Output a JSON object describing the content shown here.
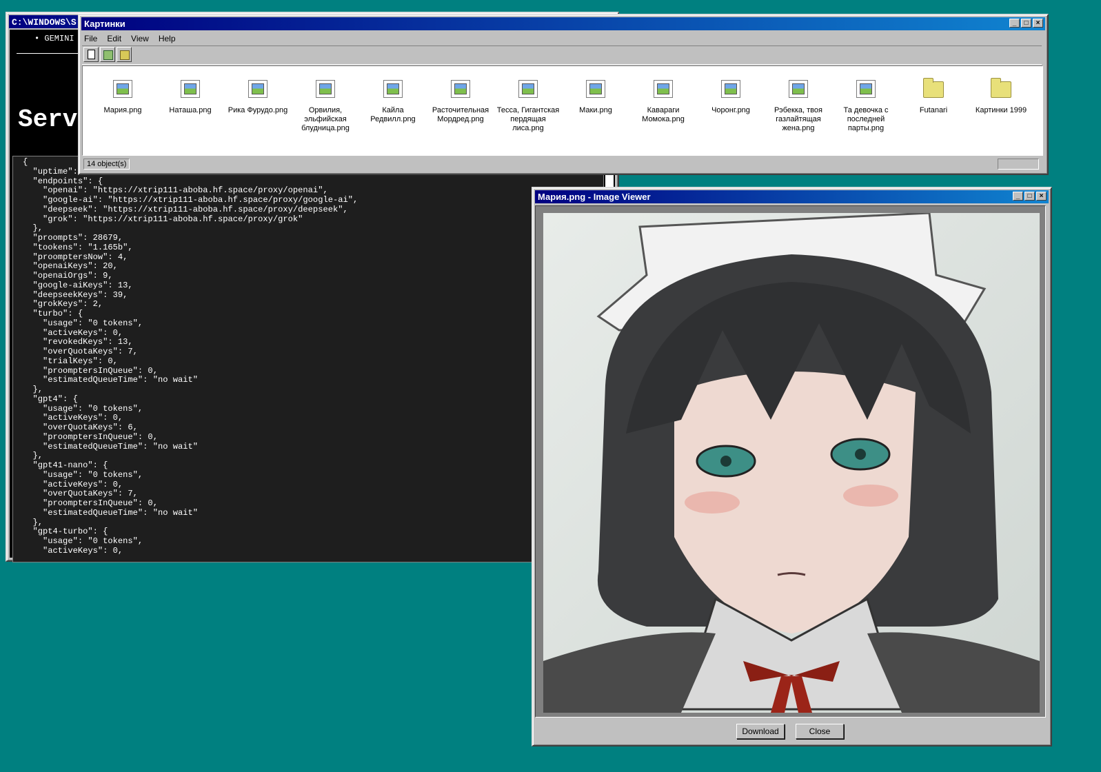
{
  "console": {
    "title": "C:\\WINDOWS\\S",
    "nav_item": "• GEMINI",
    "heading": "Serv",
    "json_text": "{\n  \"uptime\": 273824,\n  \"endpoints\": {\n    \"openai\": \"https://xtrip111-aboba.hf.space/proxy/openai\",\n    \"google-ai\": \"https://xtrip111-aboba.hf.space/proxy/google-ai\",\n    \"deepseek\": \"https://xtrip111-aboba.hf.space/proxy/deepseek\",\n    \"grok\": \"https://xtrip111-aboba.hf.space/proxy/grok\"\n  },\n  \"proompts\": 28679,\n  \"tookens\": \"1.165b\",\n  \"proomptersNow\": 4,\n  \"openaiKeys\": 20,\n  \"openaiOrgs\": 9,\n  \"google-aiKeys\": 13,\n  \"deepseekKeys\": 39,\n  \"grokKeys\": 2,\n  \"turbo\": {\n    \"usage\": \"0 tokens\",\n    \"activeKeys\": 0,\n    \"revokedKeys\": 13,\n    \"overQuotaKeys\": 7,\n    \"trialKeys\": 0,\n    \"proomptersInQueue\": 0,\n    \"estimatedQueueTime\": \"no wait\"\n  },\n  \"gpt4\": {\n    \"usage\": \"0 tokens\",\n    \"activeKeys\": 0,\n    \"overQuotaKeys\": 6,\n    \"proomptersInQueue\": 0,\n    \"estimatedQueueTime\": \"no wait\"\n  },\n  \"gpt41-nano\": {\n    \"usage\": \"0 tokens\",\n    \"activeKeys\": 0,\n    \"overQuotaKeys\": 7,\n    \"proomptersInQueue\": 0,\n    \"estimatedQueueTime\": \"no wait\"\n  },\n  \"gpt4-turbo\": {\n    \"usage\": \"0 tokens\",\n    \"activeKeys\": 0,"
  },
  "explorer": {
    "title": "Картинки",
    "menu": [
      "File",
      "Edit",
      "View",
      "Help"
    ],
    "files": [
      {
        "name": "Мария.png",
        "icon": "image-file-icon"
      },
      {
        "name": "Наташа.png",
        "icon": "image-file-icon"
      },
      {
        "name": "Рика Фурудо.png",
        "icon": "image-file-icon"
      },
      {
        "name": "Орвилия, эльфийская блудница.png",
        "icon": "image-file-icon"
      },
      {
        "name": "Кайла Редвилл.png",
        "icon": "image-file-icon"
      },
      {
        "name": "Расточительная Мордред.png",
        "icon": "image-file-icon"
      },
      {
        "name": "Тесса, Гигантская пердящая лиса.png",
        "icon": "image-file-icon"
      },
      {
        "name": "Маки.png",
        "icon": "image-file-icon"
      },
      {
        "name": "Кавараги Момока.png",
        "icon": "image-file-icon"
      },
      {
        "name": "Чоронг.png",
        "icon": "image-file-icon"
      },
      {
        "name": "Рэбекка, твоя газлайтящая жена.png",
        "icon": "image-file-icon"
      },
      {
        "name": "Та девочка с последней парты.png",
        "icon": "image-file-icon"
      },
      {
        "name": "Futanari",
        "icon": "folder-icon"
      },
      {
        "name": "Картинки 1999",
        "icon": "folder-icon"
      }
    ],
    "status": "14 object(s)"
  },
  "viewer": {
    "title": "Мария.png - Image Viewer",
    "download_label": "Download",
    "close_label": "Close"
  },
  "colors": {
    "desktop": "#008080",
    "titlebar": "#000080",
    "window_face": "#c0c0c0"
  }
}
